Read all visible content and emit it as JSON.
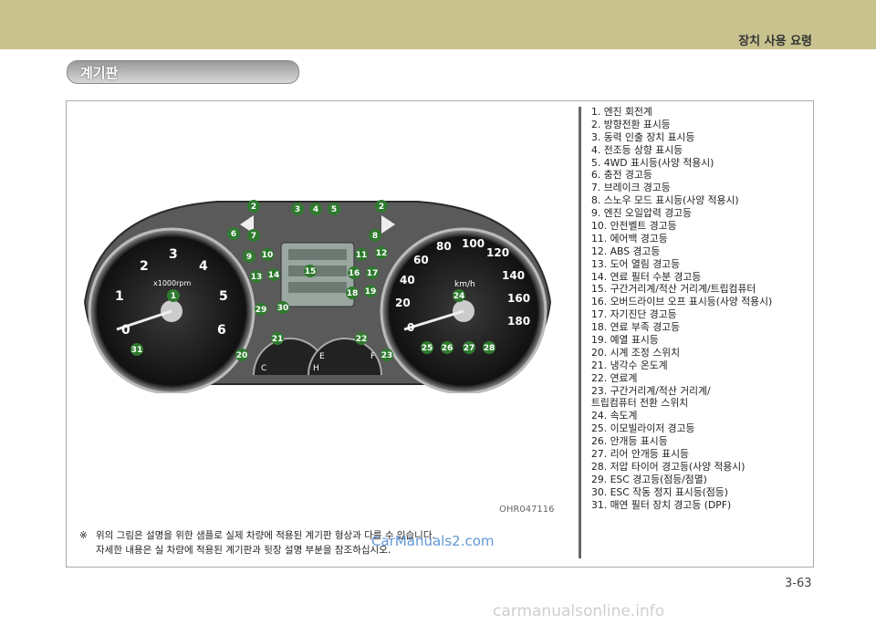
{
  "header": {
    "section_title": "장치 사용 요령"
  },
  "section_label": "계기판",
  "figure": {
    "image_code": "OHR047116",
    "gauges": {
      "tach_scale": [
        "0",
        "1",
        "2",
        "3",
        "4",
        "5",
        "6"
      ],
      "tach_unit": "x1000rpm",
      "speed_scale": [
        "0",
        "20",
        "40",
        "60",
        "80",
        "100",
        "120",
        "140",
        "160",
        "180"
      ],
      "speed_unit": "km/h",
      "temp_labels": [
        "C",
        "H"
      ],
      "fuel_labels": [
        "E",
        "F"
      ]
    },
    "callouts": [
      "1",
      "2",
      "2",
      "3",
      "4",
      "5",
      "6",
      "7",
      "8",
      "9",
      "10",
      "11",
      "12",
      "13",
      "14",
      "15",
      "16",
      "17",
      "18",
      "19",
      "20",
      "21",
      "22",
      "23",
      "24",
      "25",
      "26",
      "27",
      "28",
      "29",
      "30",
      "31"
    ]
  },
  "note": {
    "symbol": "※",
    "line1": "위의 그림은 설명을 위한 샘플로 실제 차량에 적용된 계기판 형상과 다를 수 있습니다.",
    "line2": "자세한 내용은 실 차량에 적용된 계기판과 뒷장 설명 부분을 참조하십시오."
  },
  "watermark_mid": "CarManuals2.com",
  "legend": [
    "1.   엔진 회전계",
    "2.   방향전환 표시등",
    "3.   동력 인출 장치 표시등",
    "4.   전조등 상향 표시등",
    "5.   4WD 표시등(사양 적용시)",
    "6.   충전 경고등",
    "7.   브레이크 경고등",
    "8.   스노우 모드 표시등(사양 적용시)",
    "9. 엔진 오일압력 경고등",
    "10. 안전벨트 경고등",
    "11. 에어백 경고등",
    "12. ABS 경고등",
    "13. 도어 열림 경고등",
    "14. 연료 필터 수분 경고등",
    "15. 구간거리계/적산 거리계/트립컴퓨터",
    "16. 오버드라이브 오프 표시등(사양 적용시)",
    "17. 자기진단 경고등",
    "18. 연료 부족 경고등",
    "19. 예열 표시등",
    "20. 시계 조정 스위치",
    "21. 냉각수 온도계",
    "22. 연료계",
    "23. 구간거리계/적산 거리계/",
    "       트립컴퓨터 전환 스위치",
    "24. 속도계",
    "25. 이모빌라이저 경고등",
    "26. 안개등 표시등",
    "27. 리어 안개등 표시등",
    "28. 저압 타이어 경고등(사양 적용시)",
    "29. ESC 경고등(점등/점멸)",
    "30. ESC 작동 정지 표시등(점등)",
    "31. 매연 필터 장치 경고등 (DPF)"
  ],
  "page_number": "3-63",
  "footer_watermark": "carmanualsonline.info"
}
